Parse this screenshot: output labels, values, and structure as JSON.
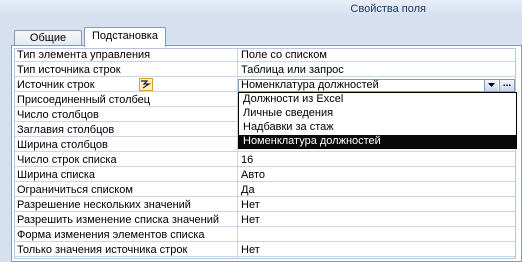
{
  "window": {
    "title": "Свойства поля"
  },
  "tabs": [
    {
      "label": "Общие",
      "active": false
    },
    {
      "label": "Подстановка",
      "active": true
    }
  ],
  "properties": [
    {
      "label": "Тип элемента управления",
      "value": "Поле со списком"
    },
    {
      "label": "Тип источника строк",
      "value": "Таблица или запрос"
    },
    {
      "label": "Источник строк",
      "value": "Номенклатура должностей"
    },
    {
      "label": "Присоединенный столбец",
      "value": ""
    },
    {
      "label": "Число столбцов",
      "value": ""
    },
    {
      "label": "Заглавия столбцов",
      "value": ""
    },
    {
      "label": "Ширина столбцов",
      "value": ""
    },
    {
      "label": "Число строк списка",
      "value": "16"
    },
    {
      "label": "Ширина списка",
      "value": "Авто"
    },
    {
      "label": "Ограничиться списком",
      "value": "Да"
    },
    {
      "label": "Разрешение нескольких значений",
      "value": "Нет"
    },
    {
      "label": "Разрешить изменение списка значений",
      "value": "Нет"
    },
    {
      "label": "Форма изменения элементов списка",
      "value": ""
    },
    {
      "label": "Только значения источника строк",
      "value": "Нет"
    }
  ],
  "combo": {
    "build_label": "..."
  },
  "dropdown": {
    "items": [
      "Должности из Excel",
      "Личные сведения",
      "Надбавки за стаж",
      "Номенклатура должностей"
    ],
    "selected_index": 3
  },
  "icons": {
    "smart_tag": "property-update-smart-tag-icon",
    "dropdown": "chevron-down-icon",
    "builder": "ellipsis-builder-icon"
  }
}
